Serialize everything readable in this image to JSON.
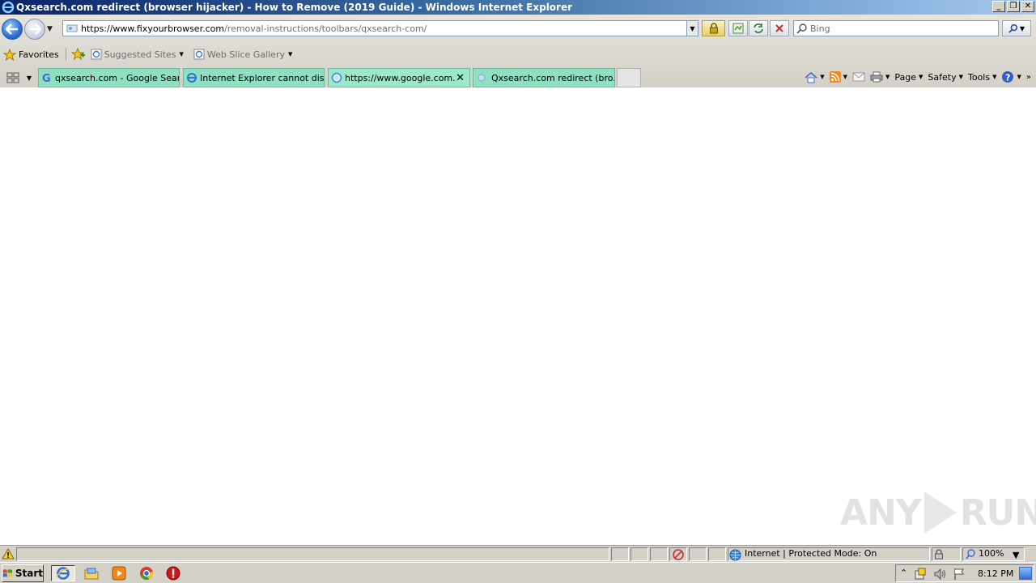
{
  "window": {
    "title": "Qxsearch.com redirect (browser hijacker) - How to Remove (2019 Guide) - Windows Internet Explorer",
    "buttons": [
      "_",
      "❐",
      "✕"
    ]
  },
  "address_bar": {
    "url_host": "https://www.fixyourbrowser.com",
    "url_path": "/removal-instructions/toolbars/qxsearch-com/"
  },
  "search": {
    "placeholder": "Bing"
  },
  "favorites_bar": {
    "favorites_label": "Favorites",
    "items": [
      {
        "label": "Suggested Sites",
        "icon": "ie-page-icon"
      },
      {
        "label": "Web Slice Gallery",
        "icon": "ie-page-icon"
      }
    ]
  },
  "tabs": [
    {
      "label": "qxsearch.com - Google Search",
      "icon": "google-icon",
      "active": false
    },
    {
      "label": "Internet Explorer cannot dis...",
      "icon": "ie-icon",
      "active": false
    },
    {
      "label": "https://www.google.com...",
      "icon": "loading-icon",
      "active": true
    },
    {
      "label": "Qxsearch.com redirect (bro...",
      "icon": "page-icon",
      "active": false
    }
  ],
  "command_bar": {
    "page": "Page",
    "safety": "Safety",
    "tools": "Tools"
  },
  "status_bar": {
    "zone": "Internet | Protected Mode: On",
    "zoom": "100%"
  },
  "taskbar": {
    "start": "Start",
    "clock": "8:12 PM"
  },
  "watermark": {
    "left": "ANY",
    "right": "RUN"
  }
}
